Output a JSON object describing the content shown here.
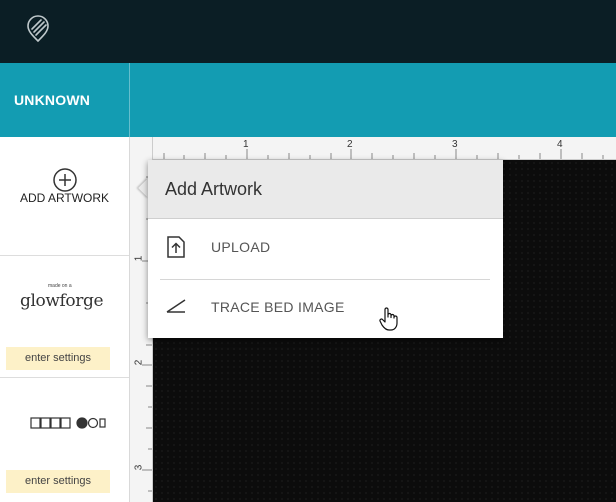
{
  "header": {
    "logo_icon": "glowforge-logo-icon",
    "background": "#0b1e25"
  },
  "status": {
    "label": "UNKNOWN",
    "background": "#139cb2"
  },
  "sidebar": {
    "add_artwork": {
      "icon": "plus-circle-icon",
      "label": "ADD ARTWORK"
    },
    "material_1": {
      "brand_small": "made on a",
      "brand": "glowforge",
      "settings_label": "enter settings"
    },
    "material_2": {
      "icon": "material-thumbnail-icon",
      "settings_label": "enter settings"
    }
  },
  "ruler": {
    "top_labels": [
      "1",
      "2",
      "3",
      "4"
    ],
    "left_labels": [
      "1",
      "2",
      "3"
    ]
  },
  "popup": {
    "title": "Add Artwork",
    "items": [
      {
        "icon": "upload-icon",
        "label": "UPLOAD"
      },
      {
        "icon": "trace-icon",
        "label": "TRACE BED IMAGE"
      }
    ]
  },
  "colors": {
    "accent": "#139cb2",
    "settings_bg": "#fdf1c8",
    "bed": "#0c0c0c"
  }
}
